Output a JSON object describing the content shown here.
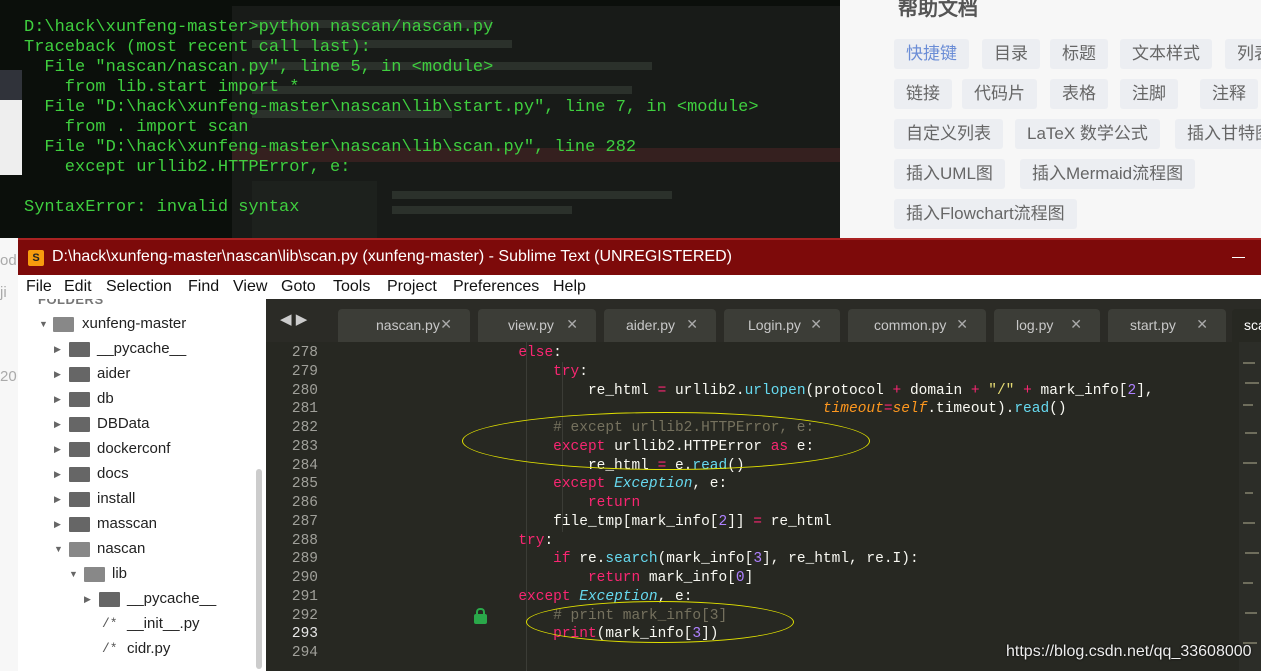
{
  "background_web": {
    "doc_title": "帮助文档",
    "tags": [
      "快捷键",
      "目录",
      "标题",
      "文本样式",
      "列表",
      "链接",
      "代码片",
      "表格",
      "注脚",
      "注释",
      "自定义列表",
      "LaTeX 数学公式",
      "插入甘特图",
      "插入UML图",
      "插入Mermaid流程图",
      "插入Flowchart流程图"
    ]
  },
  "terminal": {
    "lines": [
      "D:\\hack\\xunfeng-master>python nascan/nascan.py",
      "Traceback (most recent call last):",
      "  File \"nascan/nascan.py\", line 5, in <module>",
      "    from lib.start import *",
      "  File \"D:\\hack\\xunfeng-master\\nascan\\lib\\start.py\", line 7, in <module>",
      "    from . import scan",
      "  File \"D:\\hack\\xunfeng-master\\nascan\\lib\\scan.py\", line 282",
      "    except urllib2.HTTPError, e:",
      "",
      "SyntaxError: invalid syntax"
    ]
  },
  "window": {
    "title": "D:\\hack\\xunfeng-master\\nascan\\lib\\scan.py (xunfeng-master) - Sublime Text (UNREGISTERED)",
    "icon": "sublime-icon",
    "accent": "#7d0a0a"
  },
  "menu": [
    "File",
    "Edit",
    "Selection",
    "Find",
    "View",
    "Goto",
    "Tools",
    "Project",
    "Preferences",
    "Help"
  ],
  "sidebar": {
    "header": "FOLDERS",
    "items": [
      {
        "label": "xunfeng-master",
        "type": "folder-open"
      },
      {
        "label": "__pycache__",
        "type": "folder"
      },
      {
        "label": "aider",
        "type": "folder"
      },
      {
        "label": "db",
        "type": "folder"
      },
      {
        "label": "DBData",
        "type": "folder"
      },
      {
        "label": "dockerconf",
        "type": "folder"
      },
      {
        "label": "docs",
        "type": "folder"
      },
      {
        "label": "install",
        "type": "folder"
      },
      {
        "label": "masscan",
        "type": "folder"
      },
      {
        "label": "nascan",
        "type": "folder-open"
      },
      {
        "label": "lib",
        "type": "folder-open"
      },
      {
        "label": "__pycache__",
        "type": "folder"
      },
      {
        "label": "__init__.py",
        "type": "file"
      },
      {
        "label": "cidr.py",
        "type": "file"
      }
    ]
  },
  "tabs": [
    {
      "label": "nascan.py"
    },
    {
      "label": "view.py"
    },
    {
      "label": "aider.py"
    },
    {
      "label": "Login.py"
    },
    {
      "label": "common.py"
    },
    {
      "label": "log.py"
    },
    {
      "label": "start.py"
    },
    {
      "label": "sca",
      "active": true
    }
  ],
  "editor": {
    "line_numbers": [
      "278",
      "279",
      "280",
      "281",
      "282",
      "283",
      "284",
      "285",
      "286",
      "287",
      "288",
      "289",
      "290",
      "291",
      "292",
      "293",
      "294"
    ],
    "current_line": "293",
    "theme_colors": {
      "keyword": "#f92672",
      "function": "#66d9ef",
      "string": "#e6db74",
      "number": "#ae81ff",
      "comment": "#75715e",
      "param": "#fd971f"
    }
  },
  "watermark": "https://blog.csdn.net/qq_33608000"
}
